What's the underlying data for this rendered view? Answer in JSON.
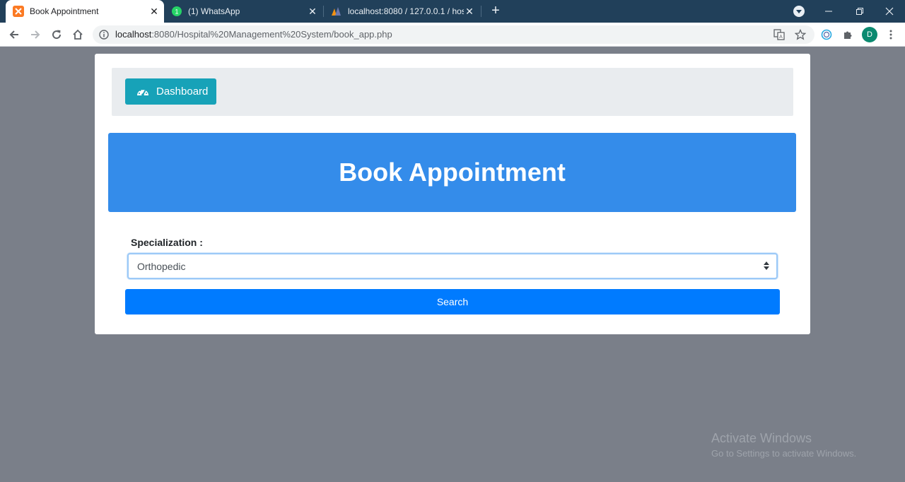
{
  "browser": {
    "tabs": [
      {
        "title": "Book Appointment",
        "icon": "xampp-icon",
        "active": true
      },
      {
        "title": "(1) WhatsApp",
        "icon": "whatsapp-icon",
        "active": false
      },
      {
        "title": "localhost:8080 / 127.0.0.1 / hosp",
        "icon": "phpmyadmin-icon",
        "active": false
      }
    ],
    "url_host": "localhost",
    "url_rest": ":8080/Hospital%20Management%20System/book_app.php",
    "profile_initial": "D",
    "accent": "#21405a"
  },
  "nav": {
    "dashboard_label": "Dashboard",
    "dashboard_color": "#17a2b8"
  },
  "banner": {
    "title": "Book Appointment",
    "color": "#348cea"
  },
  "form": {
    "specialization_label": "Specialization :",
    "specialization_value": "Orthopedic",
    "search_label": "Search",
    "search_color": "#007bff"
  },
  "watermark": {
    "line1": "Activate Windows",
    "line2": "Go to Settings to activate Windows."
  }
}
